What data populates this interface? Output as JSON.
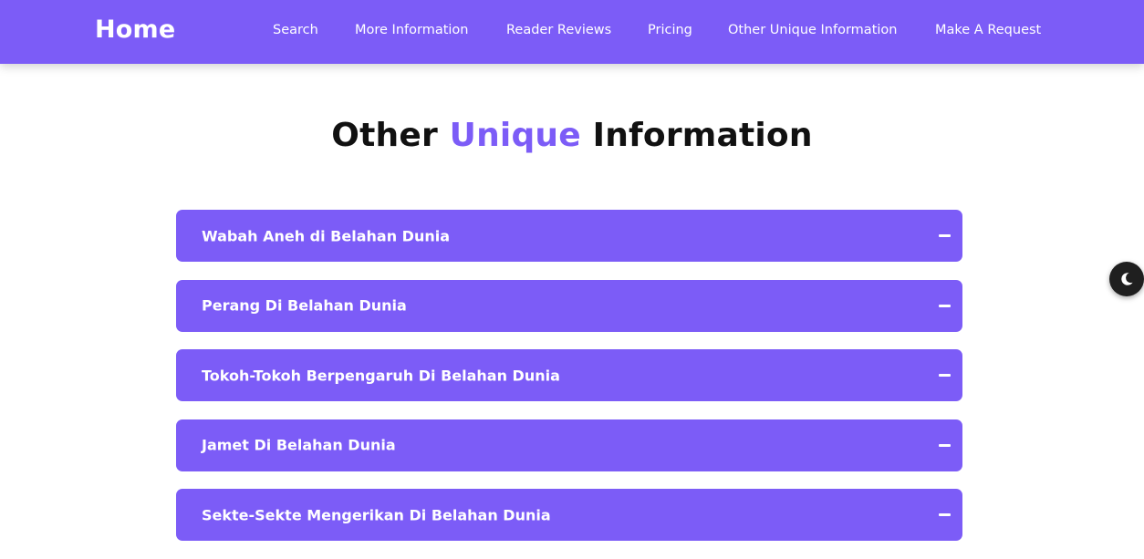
{
  "navbar": {
    "brand": "Home",
    "links": [
      {
        "label": "Search"
      },
      {
        "label": "More Information"
      },
      {
        "label": "Reader Reviews"
      },
      {
        "label": "Pricing"
      },
      {
        "label": "Other Unique Information"
      },
      {
        "label": "Make A Request"
      }
    ]
  },
  "section": {
    "title_part1": "Other ",
    "title_accent": "Unique",
    "title_part2": " Information"
  },
  "accordion": {
    "items": [
      {
        "label": "Wabah Aneh di Belahan Dunia",
        "icon": "minus-icon"
      },
      {
        "label": "Perang Di Belahan Dunia",
        "icon": "minus-icon"
      },
      {
        "label": "Tokoh-Tokoh Berpengaruh Di Belahan Dunia",
        "icon": "minus-icon"
      },
      {
        "label": "Jamet Di Belahan Dunia",
        "icon": "minus-icon"
      },
      {
        "label": "Sekte-Sekte Mengerikan Di Belahan Dunia",
        "icon": "minus-icon"
      }
    ]
  },
  "theme_toggle": {
    "icon": "moon-icon"
  },
  "colors": {
    "primary": "#7c5cf7",
    "title_text": "#111111",
    "toggle_bg": "#1f1f1f"
  }
}
